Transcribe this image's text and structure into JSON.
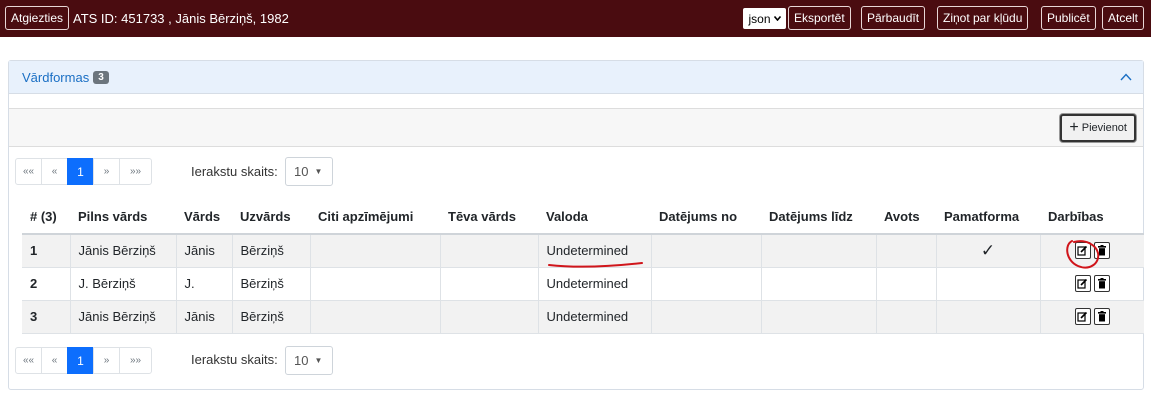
{
  "topbar": {
    "back_label": "Atgiezties",
    "title": "ATS ID: 451733 , Jānis Bērziņš, 1982",
    "format_value": "json",
    "export_label": "Eksportēt",
    "check_label": "Pārbaudīt",
    "report_label": "Ziņot par kļūdu",
    "publish_label": "Publicēt",
    "cancel_label": "Atcelt"
  },
  "panel": {
    "title": "Vārdformas",
    "count": "3",
    "add_label": "Pievienot"
  },
  "pagination": {
    "first": "««",
    "prev": "«",
    "current": "1",
    "next": "»",
    "last": "»»",
    "records_label": "Ierakstu skaits:",
    "records_value": "10"
  },
  "table": {
    "headers": [
      "# (3)",
      "Pilns vārds",
      "Vārds",
      "Uzvārds",
      "Citi apzīmējumi",
      "Tēva vārds",
      "Valoda",
      "Datējums no",
      "Datējums līdz",
      "Avots",
      "Pamatforma",
      "Darbības"
    ],
    "rows": [
      {
        "num": "1",
        "full": "Jānis Bērziņš",
        "first": "Jānis",
        "last": "Bērziņš",
        "other": "",
        "father": "",
        "lang": "Undetermined",
        "from": "",
        "to": "",
        "source": "",
        "base": "✓"
      },
      {
        "num": "2",
        "full": "J. Bērziņš",
        "first": "J.",
        "last": "Bērziņš",
        "other": "",
        "father": "",
        "lang": "Undetermined",
        "from": "",
        "to": "",
        "source": "",
        "base": ""
      },
      {
        "num": "3",
        "full": "Jānis Bērziņš",
        "first": "Jānis",
        "last": "Bērziņš",
        "other": "",
        "father": "",
        "lang": "Undetermined",
        "from": "",
        "to": "",
        "source": "",
        "base": ""
      }
    ]
  },
  "colors": {
    "topbar": "#4a0c10",
    "accent": "#0d6efd",
    "annotation": "#d0151b"
  }
}
